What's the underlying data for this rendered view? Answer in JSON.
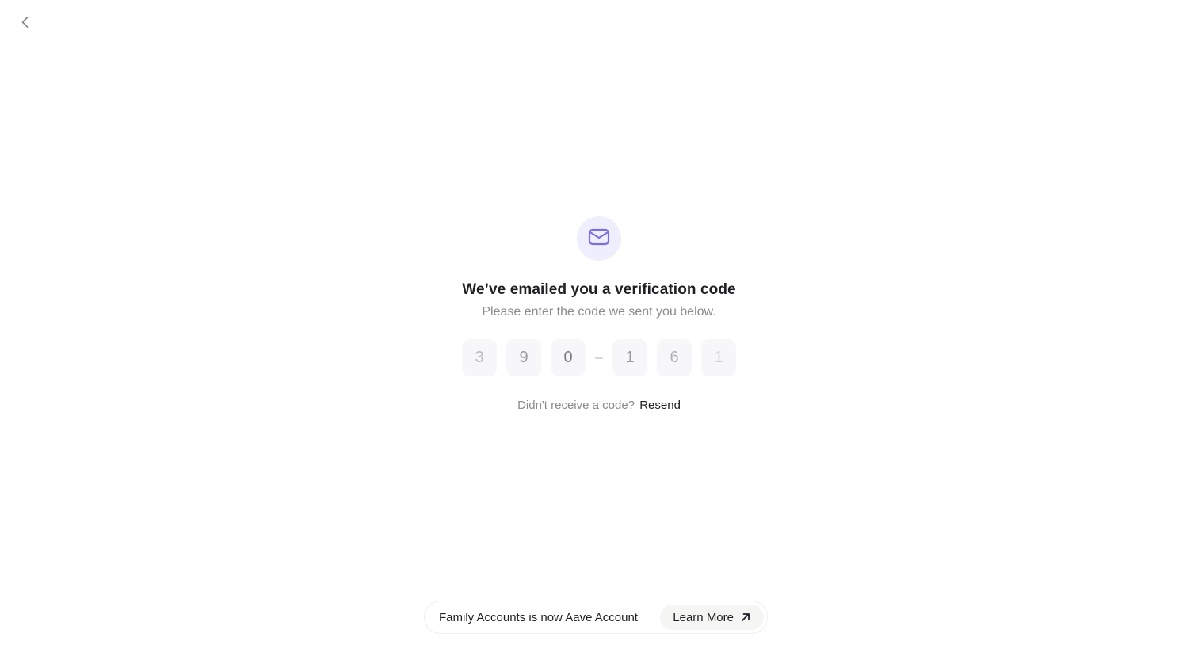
{
  "navigation": {
    "back_icon": "chevron-left-icon"
  },
  "verification": {
    "icon": "mail-icon",
    "icon_color": "#7c6fe0",
    "icon_background": "#efeefc",
    "title": "We’ve emailed you a verification code",
    "subtitle": "Please enter the code we sent you below.",
    "code_digits": [
      "3",
      "9",
      "0",
      "1",
      "6",
      "1"
    ],
    "resend_prompt": "Didn't receive a code?",
    "resend_label": "Resend"
  },
  "banner": {
    "message": "Family Accounts is now Aave Account",
    "button_label": "Learn More",
    "button_icon": "arrow-up-right-icon"
  }
}
